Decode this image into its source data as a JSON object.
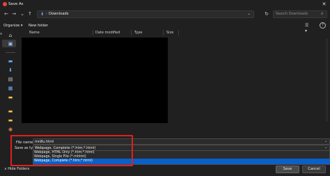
{
  "window": {
    "title": "Save As",
    "close_glyph": "✕"
  },
  "nav": {
    "back_icon": "←",
    "forward_icon": "→",
    "up_icon": "↑",
    "down_icon": "⌄",
    "address_icon": "download-folder-icon",
    "address_sep": "›",
    "address_text": "Downloads",
    "address_chevron": "⌄",
    "refresh_icon": "↻",
    "search_placeholder": "Search Downloads",
    "search_icon_glyph": "⌕"
  },
  "commands": {
    "organize": "Organize ▾",
    "new_folder": "New folder",
    "view_glyph": "☰ ▾",
    "help_glyph": "?"
  },
  "columns": {
    "name": "Name",
    "date_modified": "Date modified",
    "type": "Type",
    "size": "Size"
  },
  "form": {
    "file_name_label": "File name:",
    "file_name_value": "mn8u.html",
    "save_as_type_label": "Save as type:",
    "save_as_type_value": "Webpage, Complete (*.htm;*.html)",
    "type_options": [
      "Webpage, HTML Only (*.htm;*.html)",
      "Webpage, Single File (*.mhtml)",
      "Webpage, Complete (*.htm;*.html)"
    ],
    "dropdown_glyph": "⌄"
  },
  "footer": {
    "hide_folders": "∧  Hide Folders",
    "save_label": "Save",
    "cancel_label": "Cancel"
  },
  "colors": {
    "selection": "#0a60c8",
    "highlight_box": "#e02020",
    "folder": "#f2c14e",
    "accent": "#6ab0ff"
  }
}
